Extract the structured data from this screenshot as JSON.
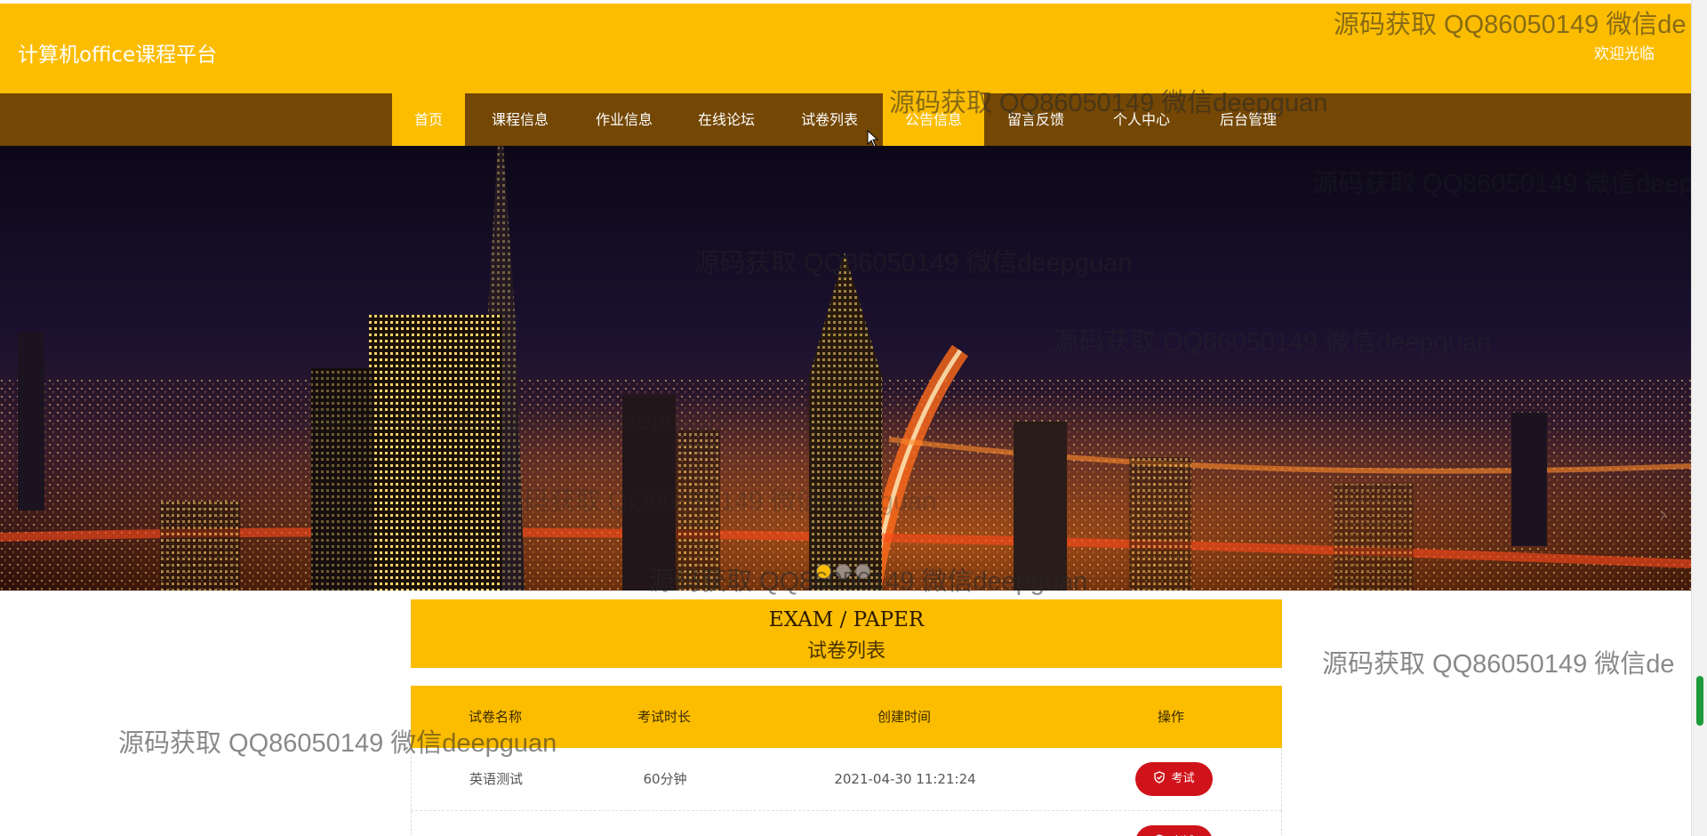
{
  "header": {
    "title": "计算机office课程平台",
    "welcome": "欢迎光临"
  },
  "nav": {
    "items": [
      {
        "label": "首页",
        "active": true
      },
      {
        "label": "课程信息",
        "active": false
      },
      {
        "label": "作业信息",
        "active": false
      },
      {
        "label": "在线论坛",
        "active": false
      },
      {
        "label": "试卷列表",
        "active": false
      },
      {
        "label": "公告信息",
        "active": true
      },
      {
        "label": "留言反馈",
        "active": false
      },
      {
        "label": "个人中心",
        "active": false
      },
      {
        "label": "后台管理",
        "active": false
      }
    ]
  },
  "banner": {
    "slides": 3,
    "active_slide": 1
  },
  "section": {
    "title_en": "EXAM / PAPER",
    "title_cn": "试卷列表"
  },
  "table": {
    "headers": [
      "试卷名称",
      "考试时长",
      "创建时间",
      "操作"
    ],
    "rows": [
      {
        "name": "英语测试",
        "duration": "60分钟",
        "created": "2021-04-30 11:21:24",
        "action": "考试"
      },
      {
        "name": "",
        "duration": "",
        "created": "",
        "action": "考试"
      }
    ]
  },
  "watermark": {
    "text_full": "源码获取 QQ86050149 微信deepguan",
    "text_cut": "源码获取 QQ86050149 微信de"
  },
  "colors": {
    "primary": "#fcbd00",
    "nav_bg": "#744704",
    "button_red": "#d0131a"
  }
}
